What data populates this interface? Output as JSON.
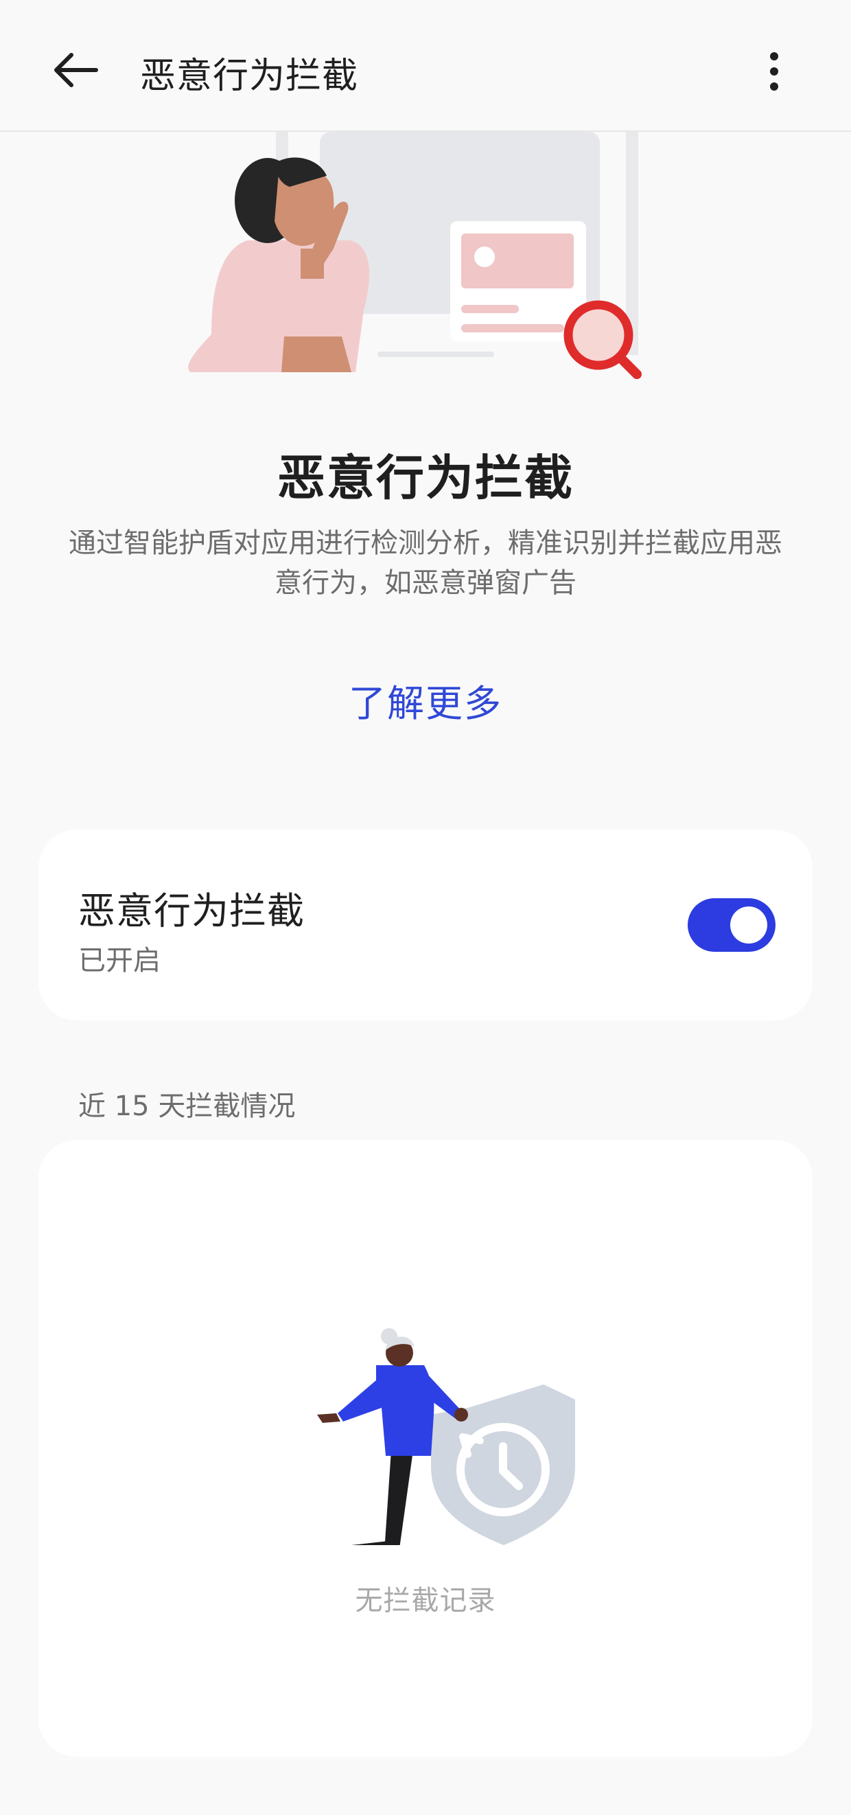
{
  "header": {
    "title": "恶意行为拦截",
    "back_icon": "arrow-left-icon",
    "more_icon": "more-vertical-icon"
  },
  "hero": {
    "illustration": "woman-thinking-magnifier-illustration",
    "title": "恶意行为拦截",
    "description": "通过智能护盾对应用进行检测分析，精准识别并拦截应用恶意行为，如恶意弹窗广告",
    "learn_more": "了解更多"
  },
  "toggle_card": {
    "title": "恶意行为拦截",
    "status": "已开启",
    "enabled": true
  },
  "records": {
    "section_label": "近 15 天拦截情况",
    "illustration": "person-with-shield-history-illustration",
    "empty_text": "无拦截记录"
  },
  "colors": {
    "accent": "#2c3ce0",
    "link": "#3048d6",
    "background": "#f9f9f9",
    "card": "#ffffff",
    "magnifier": "#e02b2b"
  }
}
